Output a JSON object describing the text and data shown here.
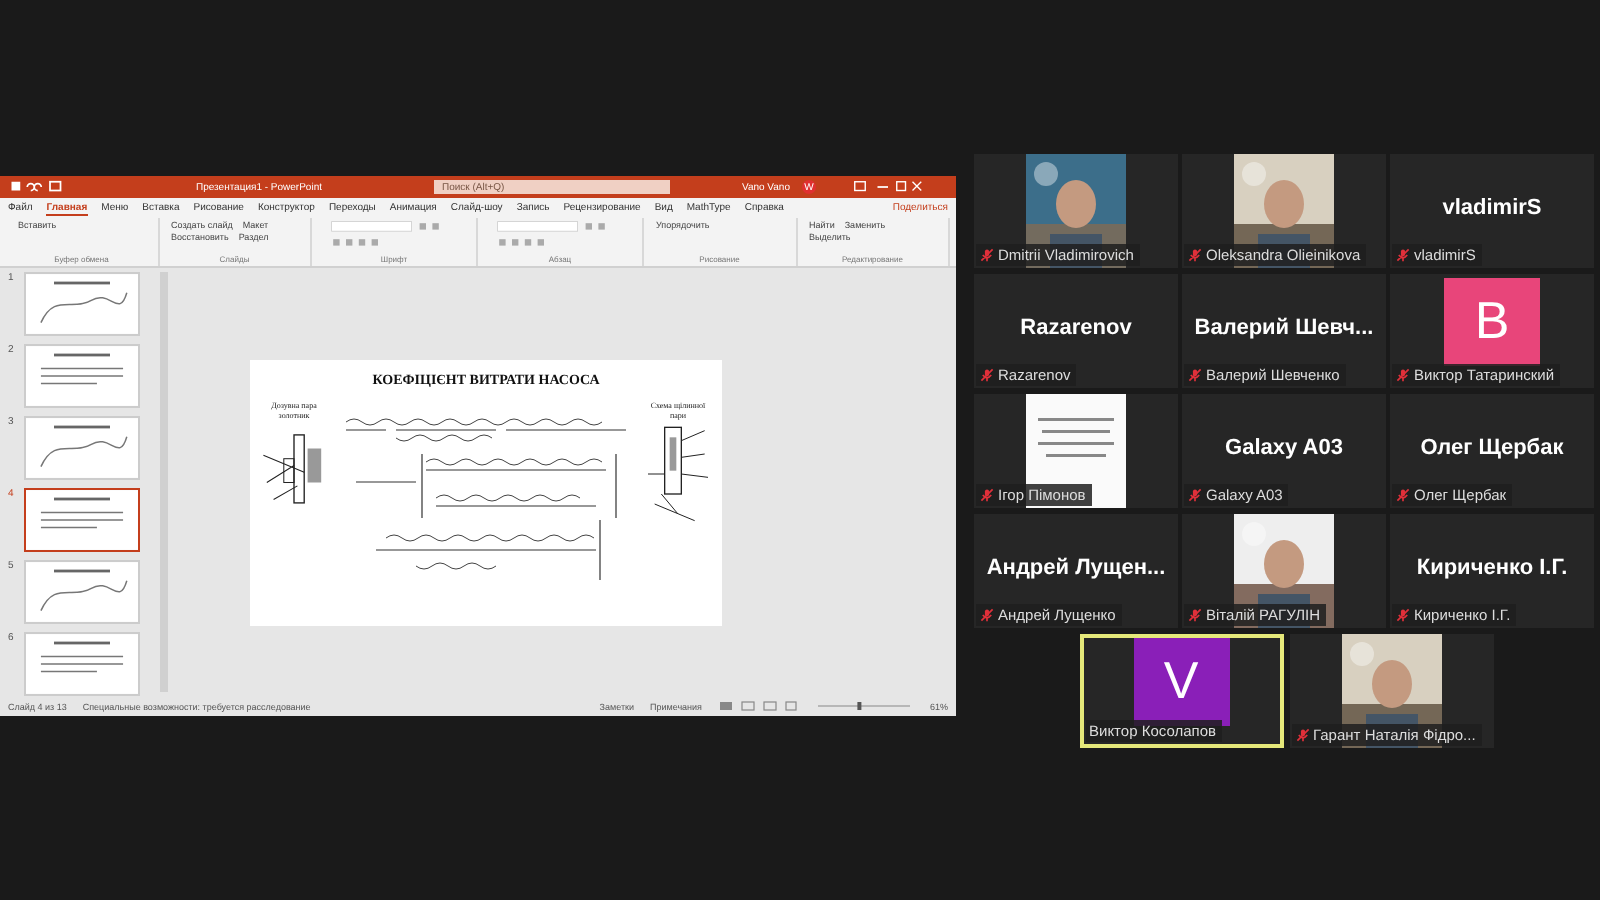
{
  "shared_screen": {
    "title_bar": {
      "title": "Презентация1 - PowerPoint",
      "search_placeholder": "Поиск (Alt+Q)",
      "user": "Vano Vano",
      "user_initial": "W"
    },
    "ribbon_tabs": [
      {
        "label": "Файл",
        "selected": false
      },
      {
        "label": "Главная",
        "selected": true
      },
      {
        "label": "Меню",
        "selected": false
      },
      {
        "label": "Вставка",
        "selected": false
      },
      {
        "label": "Рисование",
        "selected": false
      },
      {
        "label": "Конструктор",
        "selected": false
      },
      {
        "label": "Переходы",
        "selected": false
      },
      {
        "label": "Анимация",
        "selected": false
      },
      {
        "label": "Слайд-шоу",
        "selected": false
      },
      {
        "label": "Запись",
        "selected": false
      },
      {
        "label": "Рецензирование",
        "selected": false
      },
      {
        "label": "Вид",
        "selected": false
      },
      {
        "label": "MathType",
        "selected": false
      },
      {
        "label": "Справка",
        "selected": false
      }
    ],
    "share_button": "Поделиться",
    "ribbon_groups": [
      {
        "label": "Буфер обмена",
        "commands": [
          "Вставить"
        ]
      },
      {
        "label": "Слайды",
        "commands": [
          "Создать слайд",
          "Макет",
          "Восстановить",
          "Раздел"
        ]
      },
      {
        "label": "Шрифт"
      },
      {
        "label": "Абзац"
      },
      {
        "label": "Рисование",
        "commands": [
          "Упорядочить"
        ]
      },
      {
        "label": "Редактирование",
        "commands": [
          "Найти",
          "Заменить",
          "Выделить"
        ]
      }
    ],
    "thumbnails": [
      {
        "number": "1",
        "selected": false
      },
      {
        "number": "2",
        "selected": false
      },
      {
        "number": "3",
        "selected": false
      },
      {
        "number": "4",
        "selected": true
      },
      {
        "number": "5",
        "selected": false
      },
      {
        "number": "6",
        "selected": false
      }
    ],
    "slide": {
      "title": "КОЕФІЦІЄНТ ВИТРАТИ НАСОСА",
      "left_caption": "Дозувна пара золотник",
      "right_caption": "Схема щілинної пари"
    },
    "status_bar": {
      "slide_counter": "Слайд 4 из 13",
      "accessibility": "Специальные возможности: требуется расследование",
      "notes": "Заметки",
      "comments": "Примечания",
      "zoom": "61%",
      "zoom_slider": {
        "level": 0.45
      }
    }
  },
  "participants": [
    {
      "name": "Dmitrii Vladimirovich",
      "muted": true,
      "selected": false
    },
    {
      "name": "Oleksandra Olieinikova",
      "muted": true,
      "selected": false
    },
    {
      "kind": "name",
      "display": "vladimirS",
      "name": "vladimirS",
      "muted": true,
      "selected": false
    },
    {
      "kind": "name",
      "display": "Razarenov",
      "name": "Razarenov",
      "muted": true,
      "selected": false
    },
    {
      "kind": "name",
      "display": "Валерий  Шевч...",
      "name": "Валерий Шевченко",
      "muted": true,
      "selected": false
    },
    {
      "kind": "avatar",
      "letter": "B",
      "color": "#e8457a",
      "name": "Виктор Татаринский",
      "muted": true,
      "selected": false
    },
    {
      "kind": "document",
      "name": "Ігор Пімонов",
      "muted": true,
      "selected": false
    },
    {
      "kind": "name",
      "display": "Galaxy A03",
      "name": "Galaxy A03",
      "muted": true,
      "selected": false
    },
    {
      "kind": "name",
      "display": "Олег Щербак",
      "name": "Олег Щербак",
      "muted": true,
      "selected": false
    },
    {
      "kind": "name",
      "display": "Андрей  Лущен...",
      "name": "Андрей Лущенко",
      "muted": true,
      "selected": false
    },
    {
      "name": "Віталій РАГУЛІН",
      "muted": true,
      "selected": false
    },
    {
      "kind": "name",
      "display": "Кириченко І.Г.",
      "name": "Кириченко І.Г.",
      "muted": true,
      "selected": false
    },
    {
      "kind": "avatar",
      "letter": "V",
      "color": "#8a1fb8",
      "name": "Виктор Косолапов",
      "muted": false,
      "selected": true
    },
    {
      "name": "Гарант Наталія Фідро...",
      "muted": true,
      "selected": false
    }
  ]
}
